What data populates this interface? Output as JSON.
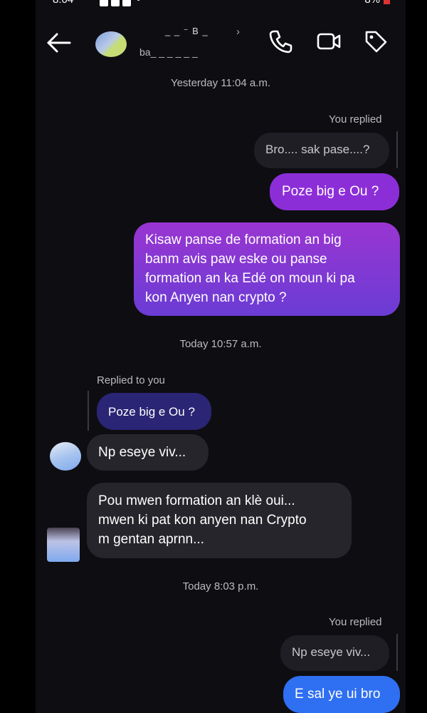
{
  "status_bar": {
    "time": "8:04",
    "battery": "8%"
  },
  "header": {
    "contact_name": "_ _ ⁻ B _",
    "username": "ba_ _ _ _ _ _",
    "icons": [
      "back-arrow-icon",
      "phone-icon",
      "video-camera-icon",
      "tag-icon"
    ]
  },
  "timestamps": {
    "t1": "Yesterday 11:04 a.m.",
    "t2": "Today 10:57 a.m.",
    "t3": "Today 8:03 p.m."
  },
  "messages": {
    "replied_label_1": "You replied",
    "quoted_1": "Bro.... sak pase....?",
    "out_1": "Poze big e Ou ?",
    "out_2": "Kisaw panse de formation an big\nbanm avis paw eske ou panse\nformation an ka Edé on moun ki pa\nkon Anyen nan crypto ?",
    "replied_to_you_label": "Replied to you",
    "quoted_2": "Poze big e Ou ?",
    "in_1": "Np eseye viv...",
    "in_2": "Pou mwen  formation an klè oui...\nmwen ki pat kon anyen nan Crypto\nm gentan aprnn...",
    "replied_label_2": "You replied",
    "quoted_3": "Np eseye viv...",
    "out_3": "E sal ye ui bro"
  },
  "colors": {
    "screen_bg": "#0e0d12",
    "incoming_bubble": "#26252b",
    "outgoing_purple": "#8c2ed8",
    "outgoing_gradient_end": "#6a3cd4",
    "outgoing_blue": "#2f6ff1",
    "quoted_navy": "#2a2574"
  }
}
